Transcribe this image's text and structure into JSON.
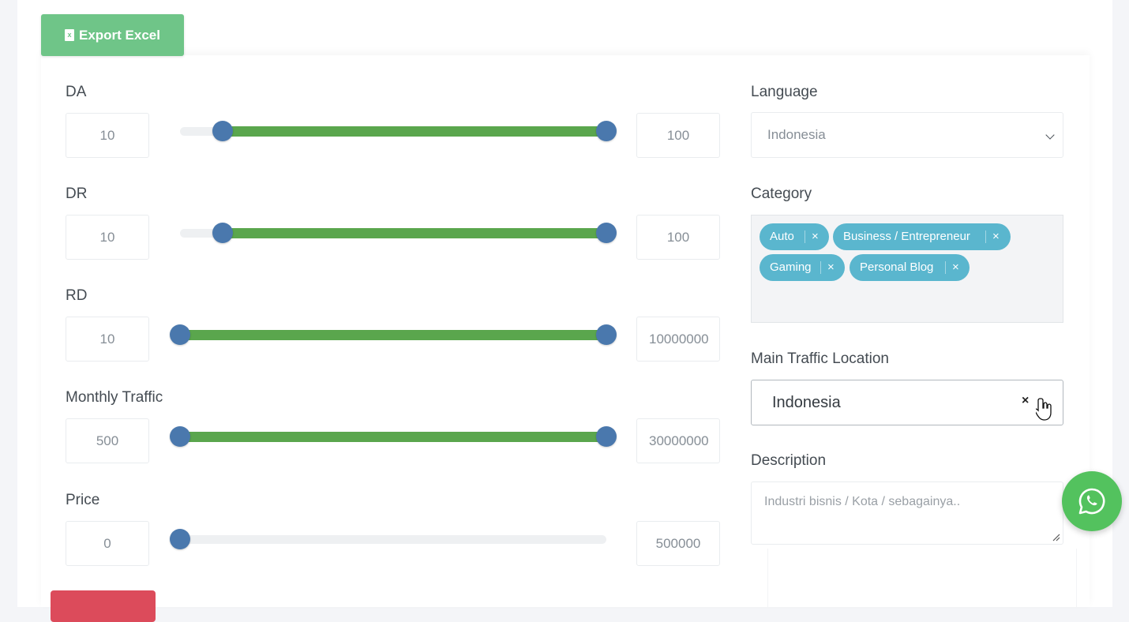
{
  "toolbar": {
    "export_label": "Export Excel",
    "export_icon": "excel-file-icon"
  },
  "filters": {
    "da": {
      "label": "DA",
      "min": "10",
      "max": "100",
      "range": [
        10,
        100
      ],
      "bounds": [
        0,
        100
      ]
    },
    "dr": {
      "label": "DR",
      "min": "10",
      "max": "100",
      "range": [
        10,
        100
      ],
      "bounds": [
        0,
        100
      ]
    },
    "rd": {
      "label": "RD",
      "min": "10",
      "max": "10000000",
      "range": [
        10,
        10000000
      ],
      "bounds": [
        10,
        10000000
      ]
    },
    "traffic": {
      "label": "Monthly Traffic",
      "min": "500",
      "max": "30000000",
      "range": [
        500,
        30000000
      ],
      "bounds": [
        500,
        30000000
      ]
    },
    "price": {
      "label": "Price",
      "min": "0",
      "max": "500000",
      "range": [
        0,
        0
      ],
      "bounds": [
        0,
        500000
      ]
    }
  },
  "language": {
    "label": "Language",
    "value": "Indonesia"
  },
  "category": {
    "label": "Category",
    "tags": [
      "Auto",
      "Business / Entrepreneur",
      "Gaming",
      "Personal Blog"
    ]
  },
  "location": {
    "label": "Main Traffic Location",
    "value": "Indonesia"
  },
  "description": {
    "label": "Description",
    "placeholder": "Industri bisnis / Kota / sebagainya.."
  },
  "colors": {
    "accent_green": "#6fc588",
    "slider_fill": "#5aa64d",
    "slider_handle": "#4a78ad",
    "tag": "#5ab6ce",
    "danger": "#dc4b5b",
    "whatsapp": "#53c25e"
  },
  "icons": {
    "chat": "whatsapp-icon",
    "dropdown": "chevron-down-icon",
    "clear": "clear-x-icon",
    "cursor": "hand-cursor-icon"
  }
}
